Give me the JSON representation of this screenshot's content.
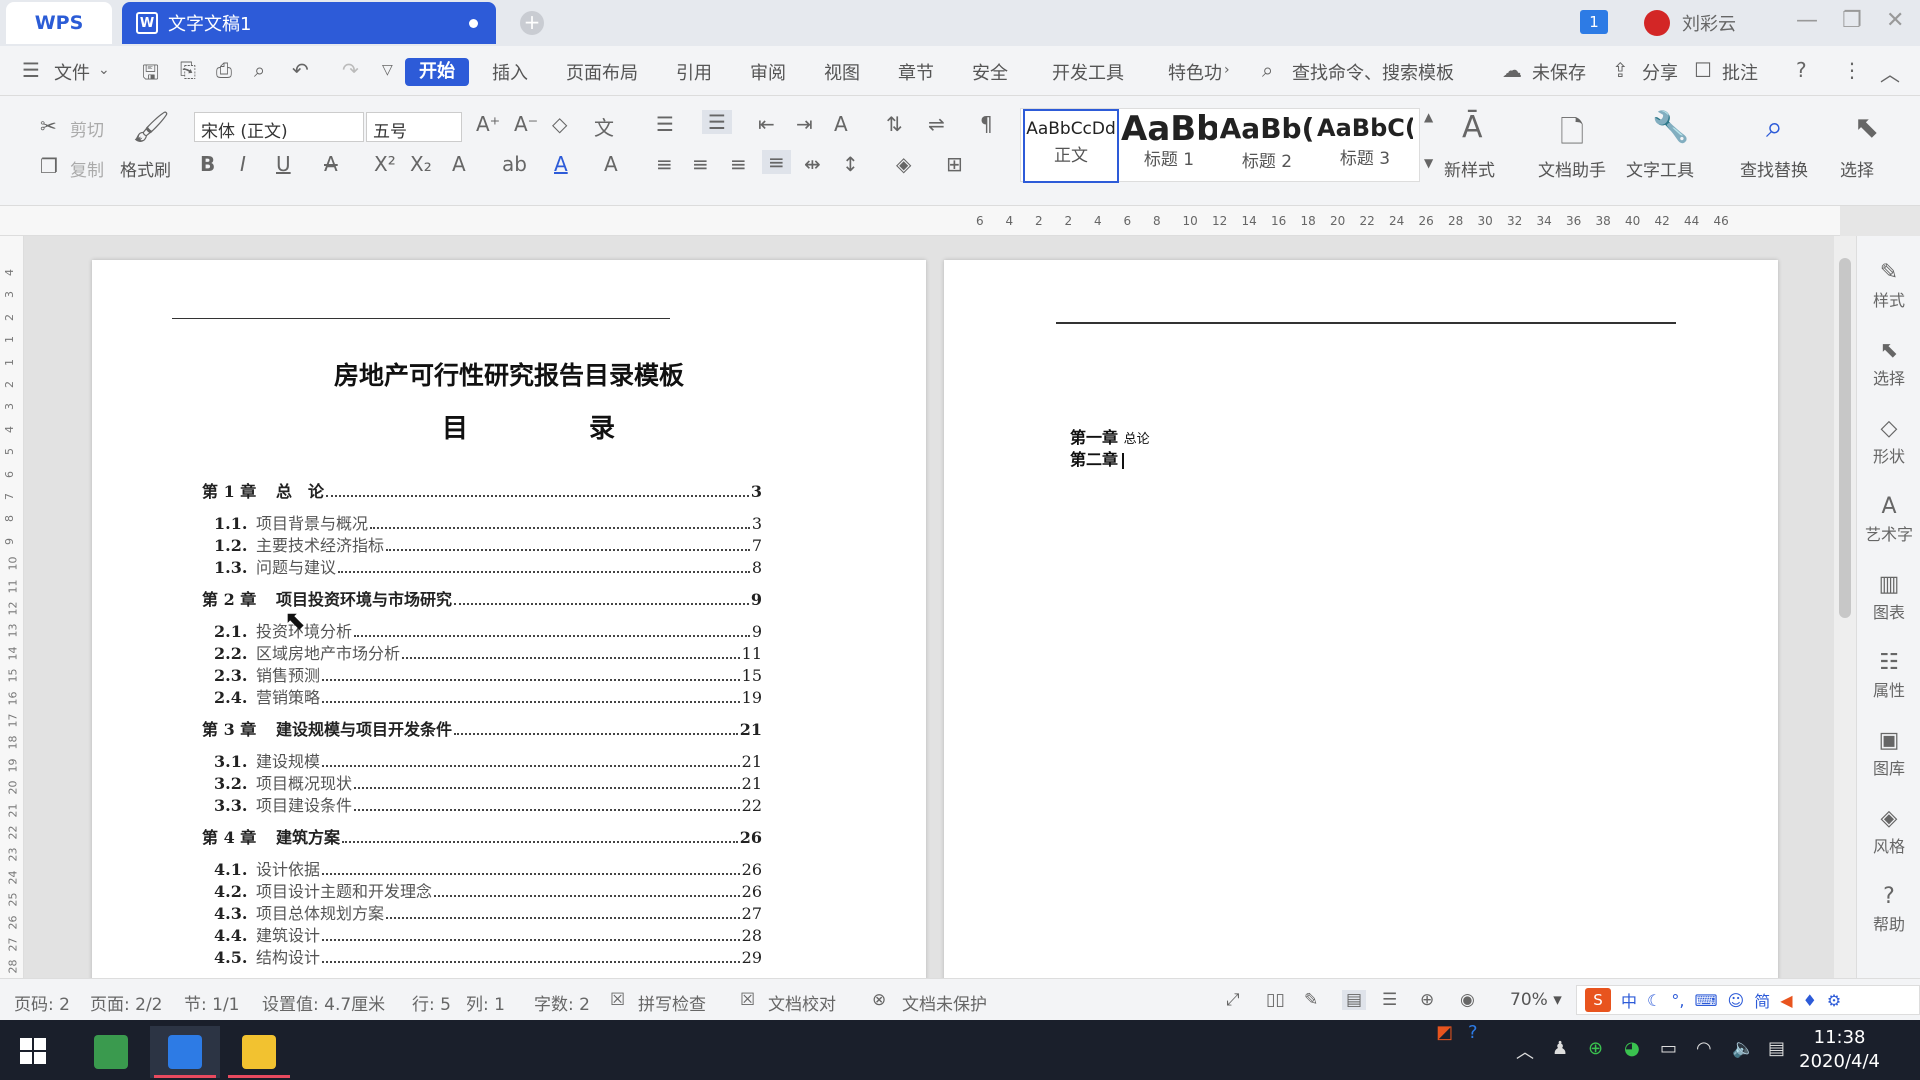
{
  "titlebar": {
    "app_name": "WPS",
    "doc_tab": "文字文稿1",
    "notification_count": "1",
    "user_name": "刘彩云"
  },
  "menubar": {
    "file_label": "文件",
    "tabs": [
      "开始",
      "插入",
      "页面布局",
      "引用",
      "审阅",
      "视图",
      "章节",
      "安全",
      "开发工具",
      "特色功"
    ],
    "search_placeholder": "查找命令、搜索模板",
    "unsaved": "未保存",
    "share": "分享",
    "comment": "批注"
  },
  "ribbon": {
    "cut": "剪切",
    "copy": "复制",
    "format_painter": "格式刷",
    "font_name": "宋体 (正文)",
    "font_size": "五号",
    "styles": [
      {
        "preview": "AaBbCcDd",
        "label": "正文"
      },
      {
        "preview": "AaBb",
        "label": "标题 1"
      },
      {
        "preview": "AaBb(",
        "label": "标题 2"
      },
      {
        "preview": "AaBbC(",
        "label": "标题 3"
      }
    ],
    "new_style": "新样式",
    "doc_assistant": "文档助手",
    "text_tools": "文字工具",
    "find_replace": "查找替换",
    "select": "选择"
  },
  "ruler": {
    "marks": [
      "6",
      "4",
      "2",
      "2",
      "4",
      "6",
      "8",
      "10",
      "12",
      "14",
      "16",
      "18",
      "20",
      "22",
      "24",
      "26",
      "28",
      "30",
      "32",
      "34",
      "36",
      "38",
      "40",
      "42",
      "44",
      "46"
    ],
    "v_marks": [
      "4",
      "3",
      "2",
      "1",
      "1",
      "2",
      "3",
      "4",
      "5",
      "6",
      "7",
      "8",
      "9",
      "10",
      "11",
      "12",
      "13",
      "14",
      "15",
      "16",
      "17",
      "18",
      "19",
      "20",
      "21",
      "22",
      "23",
      "24",
      "25",
      "26",
      "27",
      "28"
    ]
  },
  "page1": {
    "title": "房地产可行性研究报告目录模板",
    "toc_heading": "目  录",
    "toc": [
      {
        "type": "ch",
        "num": "第 1 章",
        "text": "总　论",
        "page": "3"
      },
      {
        "type": "sub",
        "num": "1.1.",
        "text": "项目背景与概况",
        "page": "3"
      },
      {
        "type": "sub",
        "num": "1.2.",
        "text": "主要技术经济指标",
        "page": "7"
      },
      {
        "type": "sub",
        "num": "1.3.",
        "text": "问题与建议",
        "page": "8"
      },
      {
        "type": "ch",
        "num": "第 2 章",
        "text": "项目投资环境与市场研究",
        "page": "9"
      },
      {
        "type": "sub",
        "num": "2.1.",
        "text": "投资环境分析",
        "page": "9"
      },
      {
        "type": "sub",
        "num": "2.2.",
        "text": "区域房地产市场分析",
        "page": "11"
      },
      {
        "type": "sub",
        "num": "2.3.",
        "text": "销售预测",
        "page": "15"
      },
      {
        "type": "sub",
        "num": "2.4.",
        "text": "营销策略",
        "page": "19"
      },
      {
        "type": "ch",
        "num": "第 3 章",
        "text": "建设规模与项目开发条件",
        "page": "21"
      },
      {
        "type": "sub",
        "num": "3.1.",
        "text": "建设规模",
        "page": "21"
      },
      {
        "type": "sub",
        "num": "3.2.",
        "text": "项目概况现状",
        "page": "21"
      },
      {
        "type": "sub",
        "num": "3.3.",
        "text": "项目建设条件",
        "page": "22"
      },
      {
        "type": "ch",
        "num": "第 4 章",
        "text": "建筑方案",
        "page": "26"
      },
      {
        "type": "sub",
        "num": "4.1.",
        "text": "设计依据",
        "page": "26"
      },
      {
        "type": "sub",
        "num": "4.2.",
        "text": "项目设计主题和开发理念",
        "page": "26"
      },
      {
        "type": "sub",
        "num": "4.3.",
        "text": "项目总体规划方案",
        "page": "27"
      },
      {
        "type": "sub",
        "num": "4.4.",
        "text": "建筑设计",
        "page": "28"
      },
      {
        "type": "sub",
        "num": "4.5.",
        "text": "结构设计",
        "page": "29"
      }
    ]
  },
  "page2": {
    "line1_bold": "第一章",
    "line1_small": "总论",
    "line2_bold": "第二章"
  },
  "right_panel": [
    "样式",
    "选择",
    "形状",
    "艺术字",
    "图表",
    "属性",
    "图库",
    "风格",
    "帮助"
  ],
  "statusbar": {
    "page_num": "页码: 2",
    "pages": "页面: 2/2",
    "section": "节: 1/1",
    "setting": "设置值: 4.7厘米",
    "row": "行: 5",
    "col": "列: 1",
    "words": "字数: 2",
    "spell": "拼写检查",
    "proof": "文档校对",
    "protect": "文档未保护",
    "zoom": "70%",
    "ime_cn": "中",
    "ime_simp": "简"
  },
  "taskbar": {
    "time": "11:38",
    "date": "2020/4/4"
  }
}
